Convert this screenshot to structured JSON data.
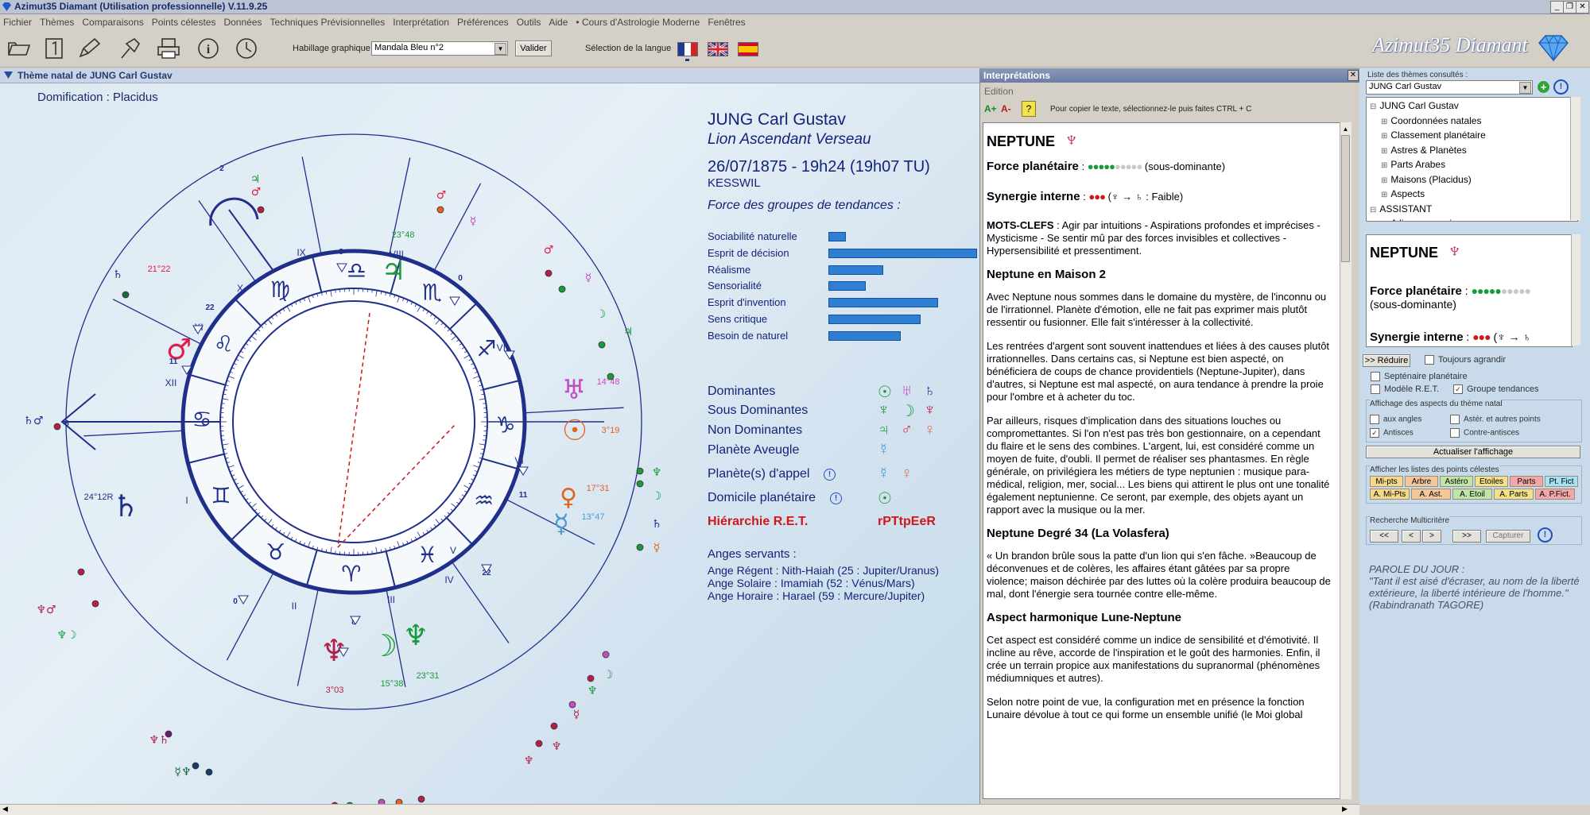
{
  "app": {
    "title": "Azimut35 Diamant (Utilisation professionnelle) V.11.9.25",
    "logo_text": "Azimut35 Diamant"
  },
  "menu": [
    "Fichier",
    "Thèmes",
    "Comparaisons",
    "Points célestes",
    "Données",
    "Techniques Prévisionnelles",
    "Interprétation",
    "Préférences",
    "Outils",
    "Aide",
    "• Cours d'Astrologie Moderne",
    "Fenêtres"
  ],
  "toolbar": {
    "habillage_label": "Habillage graphique",
    "habillage_value": "Mandala Bleu n°2",
    "valider": "Valider",
    "langue_label": "Sélection de la langue"
  },
  "chart_panel": {
    "title": "Thème natal de JUNG Carl Gustav",
    "domification": "Domification : Placidus"
  },
  "wheel": {
    "house_numbers": [
      "IX",
      "VIII",
      "X",
      "XI",
      "XII",
      "VII",
      "VI",
      "V",
      "I",
      "II",
      "III",
      "IV"
    ],
    "degree_labels": [
      "23°48",
      "21°22",
      "14°48",
      "3°19",
      "17°31",
      "13°47",
      "24°12R",
      "3°03",
      "15°38",
      "23°31"
    ],
    "cusp_labels": [
      "2",
      "8",
      "0",
      "22",
      "11",
      "6",
      "11",
      "22",
      "0",
      "8"
    ]
  },
  "subject": {
    "name": "JUNG Carl Gustav",
    "sign": "Lion Ascendant Verseau",
    "datetime": "26/07/1875 - 19h24 (19h07 TU)",
    "place": "KESSWIL",
    "forces_title": "Force des groupes de tendances :"
  },
  "tendances": [
    {
      "label": "Sociabilité naturelle",
      "value": 0.08
    },
    {
      "label": "Esprit de décision",
      "value": 0.68
    },
    {
      "label": "Réalisme",
      "value": 0.25
    },
    {
      "label": "Sensorialité",
      "value": 0.17
    },
    {
      "label": "Esprit d'invention",
      "value": 0.5
    },
    {
      "label": "Sens critique",
      "value": 0.42
    },
    {
      "label": "Besoin de naturel",
      "value": 0.33
    }
  ],
  "planets_summary": [
    {
      "label": "Dominantes",
      "symbols": "☉ ♅ ♄",
      "colors": [
        "#1a9a3a",
        "#c24cc0",
        "#2a3a9a"
      ]
    },
    {
      "label": "Sous Dominantes",
      "symbols": "♆ ☽ ♆",
      "colors": [
        "#1a9a3a",
        "#1a9a3a",
        "#c0204a"
      ]
    },
    {
      "label": "Non Dominantes",
      "symbols": "♃ ♂ ♀",
      "colors": [
        "#1a9a3a",
        "#d0304a",
        "#e07050"
      ]
    },
    {
      "label": "Planète Aveugle",
      "symbols": "☿",
      "colors": [
        "#4a9ad0"
      ]
    },
    {
      "label": "Planète(s) d'appel",
      "symbols": "☿ ♀",
      "colors": [
        "#4a9ad0",
        "#e07050"
      ]
    },
    {
      "label": "Domicile planétaire",
      "symbols": "☉",
      "colors": [
        "#1a9a3a"
      ]
    }
  ],
  "hierarchie": {
    "label": "Hiérarchie R.E.T.",
    "value": "rPTtpEeR"
  },
  "anges": {
    "title": "Anges servants :",
    "lines": [
      "Ange Régent : Nith-Haiah (25 : Jupiter/Uranus)",
      "Ange Solaire : Imamiah (52 : Vénus/Mars)",
      "Ange Horaire : Harael (59 : Mercure/Jupiter)"
    ]
  },
  "interpretations": {
    "title": "Interprétations",
    "edition": "Edition",
    "font_plus": "A+",
    "font_minus": "A-",
    "copy_hint": "Pour copier le texte, sélectionnez-le puis faites CTRL + C",
    "planet": "NEPTUNE",
    "force_label": "Force planétaire",
    "force_value": "(sous-dominante)",
    "synergie_label": "Synergie interne",
    "synergie_value": ": Faible)",
    "mots_clefs_label": "MOTS-CLEFS",
    "mots_clefs": " : Agir par intuitions - Aspirations profondes et imprécises - Mysticisme - Se sentir mû par des forces invisibles et collectives - Hypersensibilité et pressentiment.",
    "section1_title": "Neptune en Maison 2",
    "section1_p1": "Avec Neptune nous sommes dans le domaine du mystère, de l'inconnu ou de l'irrationnel. Planète d'émotion, elle ne fait pas exprimer mais plutôt ressentir ou fusionner. Elle fait s'intéresser à la collectivité.",
    "section1_p2": "Les rentrées d'argent sont souvent inattendues et liées à des causes plutôt irrationnelles. Dans certains cas, si Neptune est bien aspecté, on bénéficiera de coups de chance providentiels (Neptune-Jupiter), dans d'autres, si Neptune est mal aspecté, on aura tendance à prendre la proie pour l'ombre et à acheter du toc.",
    "section1_p3": "Par ailleurs, risques d'implication dans des situations louches ou compromettantes. Si l'on n'est pas très bon gestionnaire, on a cependant du flaire et le sens des combines. L'argent, lui, est considéré comme un moyen de fuite, d'oubli. Il permet de réaliser ses phantasmes. En règle générale, on privilégiera les métiers de type neptunien : musique para-médical, religion, mer, social... Les biens qui attirent le plus ont une tonalité également neptunienne. Ce seront, par exemple, des objets ayant un rapport avec la musique ou la mer.",
    "section2_title": "Neptune Degré 34 (La Volasfera)",
    "section2_p1": "« Un brandon brûle sous la patte d'un lion qui s'en fâche. »Beaucoup de déconvenues et de colères, les affaires étant gâtées par sa propre violence; maison déchirée par des luttes où la colère produira beaucoup de mal, dont l'énergie sera tournée contre elle-même.",
    "section3_title": "Aspect harmonique Lune-Neptune",
    "section3_p1": "Cet aspect est considéré comme un indice de sensibilité et d'émotivité. Il incline au rêve, accorde de l'inspiration et le goût des harmonies. Enfin, il crée un terrain propice aux manifestations du supranormal (phénomènes médiumniques et autres).",
    "section3_p2": "Selon notre point de vue, la configuration met en présence la fonction Lunaire dévolue à tout ce qui forme un ensemble unifié (le Moi global"
  },
  "right_panel": {
    "list_label": "Liste des thèmes consultés :",
    "theme_value": "JUNG Carl Gustav",
    "tree": [
      "JUNG Carl Gustav",
      "Coordonnées natales",
      "Classement planétaire",
      "Astres & Planètes",
      "Parts Arabes",
      "Maisons (Placidus)",
      "Aspects",
      "ASSISTANT",
      "A lire en premier"
    ],
    "mini_planet": "NEPTUNE",
    "mini_force_label": "Force planétaire",
    "mini_force_value": "(sous-dominante)",
    "mini_synergie_label": "Synergie interne",
    "reduire": ">> Réduire",
    "toujours_agrandir": "Toujours agrandir",
    "septenaire": "Septénaire planétaire",
    "modele_ret": "Modèle R.E.T.",
    "groupe_tendances": "Groupe tendances",
    "affichage_aspects": "Affichage des aspects du thème natal",
    "aux_angles": "aux angles",
    "aster_autres": "Astér. et autres points",
    "antisces": "Antisces",
    "contre_antisces": "Contre-antisces",
    "actualiser": "Actualiser l'affichage",
    "listes_label": "Afficher les listes des points célestes",
    "pills_row1": [
      "Mi-pts",
      "Arbre",
      "Astéro",
      "Etoiles",
      "Parts",
      "Pt. Fict"
    ],
    "pills_row2": [
      "A. Mi-Pts",
      "A. Ast.",
      "A. Etoil",
      "A. Parts",
      "A. P.Fict."
    ],
    "pill_colors": [
      "#f6d88a",
      "#f2c89a",
      "#bfe6a8",
      "#f2e08a",
      "#f2a8a8",
      "#a8e2f2"
    ],
    "recherche_label": "Recherche Multicritère",
    "nav_buttons": [
      "<<",
      "<",
      ">",
      ">>"
    ],
    "capturer": "Capturer",
    "parole_title": "PAROLE DU JOUR :",
    "parole_text": "\"Tant il est aisé d'écraser, au nom de la liberté extérieure, la liberté intérieure de l'homme.\"",
    "parole_author": "(Rabindranath TAGORE)"
  }
}
